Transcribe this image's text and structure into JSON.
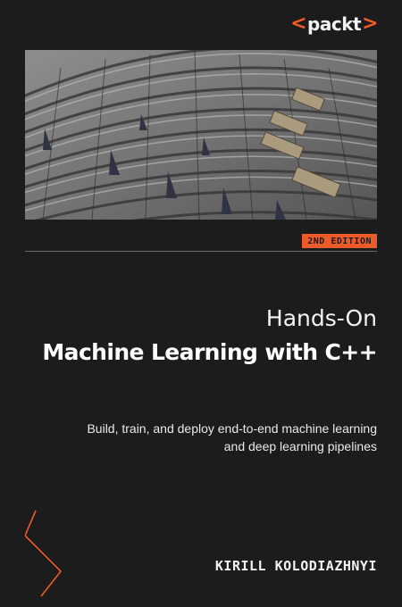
{
  "publisher": {
    "open_bracket": "<",
    "name": "packt",
    "close_bracket": ">"
  },
  "edition_badge": "2ND EDITION",
  "title": {
    "line1": "Hands-On",
    "line2": "Machine Learning with C++"
  },
  "subtitle": "Build, train, and deploy end-to-end machine learning and deep learning pipelines",
  "author": "KIRILL KOLODIAZHNYI",
  "colors": {
    "background": "#1c1c1c",
    "accent": "#ee5b2a",
    "text": "#ffffff"
  },
  "icons": {
    "decoration": "chevron-right-icon",
    "image": "stadium-seating-photo"
  }
}
